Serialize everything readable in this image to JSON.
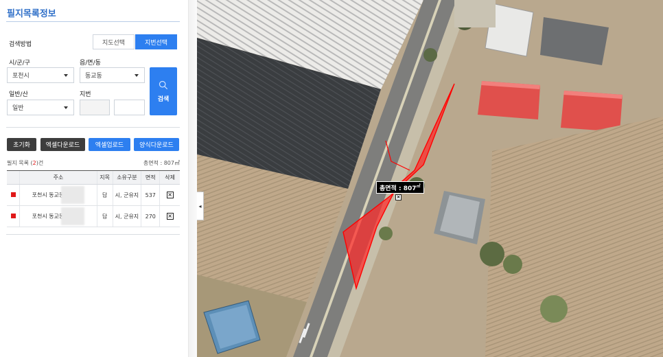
{
  "panel": {
    "title": "필지목록정보",
    "search_method_label": "검색방법",
    "tabs": [
      {
        "label": "지도선택",
        "active": false
      },
      {
        "label": "지번선택",
        "active": true
      }
    ],
    "fields": {
      "sigungu_label": "시/군/구",
      "sigungu_value": "포천시",
      "eupmyeon_label": "읍/면/동",
      "eupmyeon_value": "동교동",
      "ilban_label": "일반/산",
      "ilban_value": "일반",
      "jibun_label": "지번"
    },
    "search_button": "검색",
    "actions": {
      "reset": "초기화",
      "excel_download": "엑셀다운로드",
      "excel_upload": "엑셀업로드",
      "form_download": "양식다운로드"
    },
    "list": {
      "count_prefix": "필지 목록 (",
      "count": "2",
      "count_suffix": ")건",
      "total_area": "총면적 : 807㎡"
    },
    "table": {
      "headers": [
        "",
        "주소",
        "지목",
        "소유구분",
        "면적",
        "삭제"
      ],
      "rows": [
        {
          "address": "포천시 동교동",
          "jimok": "답",
          "owner": "시, 군유지",
          "area": "537"
        },
        {
          "address": "포천시 동교동",
          "jimok": "답",
          "owner": "시, 군유지",
          "area": "270"
        }
      ]
    }
  },
  "map": {
    "tooltip_prefix": "총면적 : 807",
    "tooltip_unit": "㎡",
    "colors": {
      "parcel_fill": "#ff2a2a",
      "roof_red": "#e0504c",
      "accent_blue": "#2d7ff0"
    }
  }
}
